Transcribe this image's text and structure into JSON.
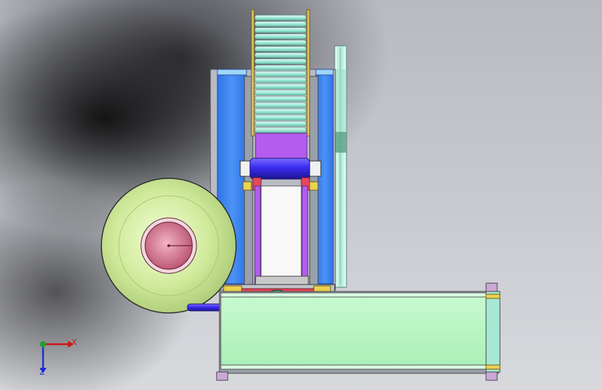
{
  "view": {
    "background_top": "#b7bac1",
    "background_bottom": "#d7d9dd"
  },
  "colors": {
    "frame_blue": "#3f86f2",
    "roller_cyan": "#a8f2df",
    "violet_block": "#b55cf0",
    "roller_blue": "#3a2cf0",
    "spool_green": "#cfe99a",
    "hub_pink": "#d8708f",
    "base_green": "#b7f5c2",
    "part_red": "#e8465a",
    "part_yellow": "#ead24d",
    "part_dark_green": "#2e6e3a"
  },
  "triad": {
    "x_label": "X",
    "z_label": "Z",
    "x_color": "#d21414",
    "y_color": "#1fa22c",
    "z_color": "#1d2bd6"
  }
}
